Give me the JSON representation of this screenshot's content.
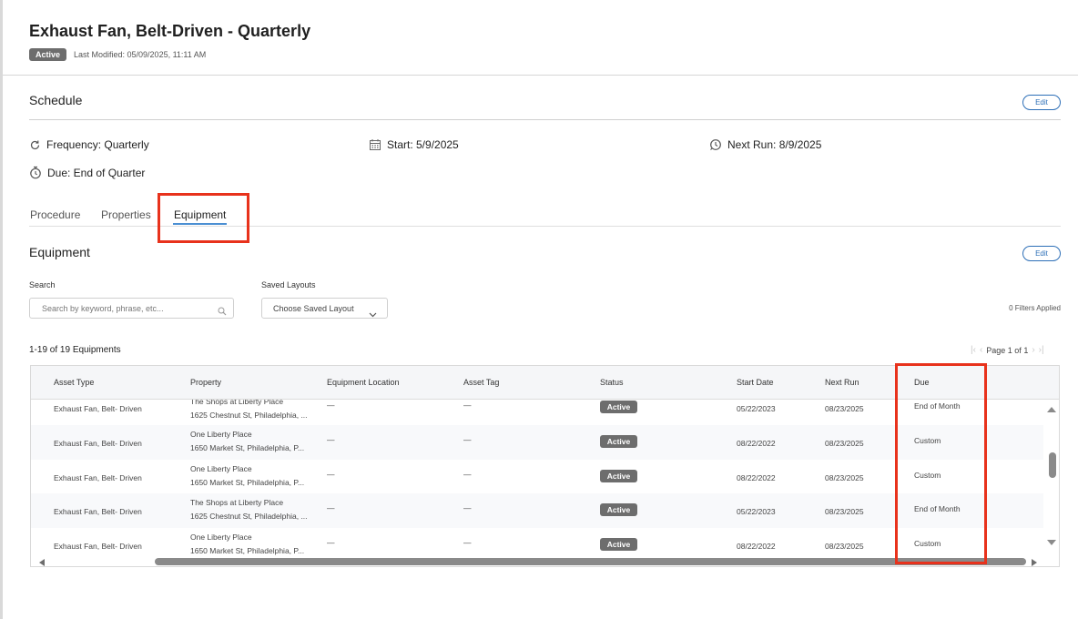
{
  "header": {
    "title": "Exhaust Fan, Belt-Driven - Quarterly",
    "status": "Active",
    "last_modified": "Last Modified: 05/09/2025, 11:11 AM"
  },
  "schedule": {
    "title": "Schedule",
    "edit_label": "Edit",
    "frequency": "Frequency: Quarterly",
    "start": "Start: 5/9/2025",
    "next_run": "Next Run: 8/9/2025",
    "due": "Due: End of Quarter"
  },
  "tabs": [
    {
      "label": "Procedure",
      "active": false
    },
    {
      "label": "Properties",
      "active": false
    },
    {
      "label": "Equipment",
      "active": true
    }
  ],
  "equipment": {
    "title": "Equipment",
    "edit_label": "Edit",
    "search_label": "Search",
    "search_placeholder": "Search by keyword, phrase, etc...",
    "saved_layouts_label": "Saved Layouts",
    "saved_layouts_value": "Choose Saved Layout",
    "filters_applied": "0 Filters Applied",
    "count": "1-19 of 19 Equipments",
    "page_label": "Page 1 of 1"
  },
  "table": {
    "columns": [
      "Asset Type",
      "Property",
      "Equipment Location",
      "Asset Tag",
      "Status",
      "Start Date",
      "Next Run",
      "Due"
    ],
    "rows": [
      {
        "asset_type": "Exhaust Fan, Belt- Driven",
        "property_name": "The Shops at Liberty Place",
        "property_address": "1625 Chestnut St, Philadelphia, ...",
        "location": "—",
        "asset_tag": "—",
        "status": "Active",
        "start_date": "05/22/2023",
        "next_run": "08/23/2025",
        "due": "End of Month"
      },
      {
        "asset_type": "Exhaust Fan, Belt- Driven",
        "property_name": "One Liberty Place",
        "property_address": "1650 Market St, Philadelphia, P...",
        "location": "—",
        "asset_tag": "—",
        "status": "Active",
        "start_date": "08/22/2022",
        "next_run": "08/23/2025",
        "due": "Custom"
      },
      {
        "asset_type": "Exhaust Fan, Belt- Driven",
        "property_name": "One Liberty Place",
        "property_address": "1650 Market St, Philadelphia, P...",
        "location": "—",
        "asset_tag": "—",
        "status": "Active",
        "start_date": "08/22/2022",
        "next_run": "08/23/2025",
        "due": "Custom"
      },
      {
        "asset_type": "Exhaust Fan, Belt- Driven",
        "property_name": "The Shops at Liberty Place",
        "property_address": "1625 Chestnut St, Philadelphia, ...",
        "location": "—",
        "asset_tag": "—",
        "status": "Active",
        "start_date": "05/22/2023",
        "next_run": "08/23/2025",
        "due": "End of Month"
      },
      {
        "asset_type": "Exhaust Fan, Belt- Driven",
        "property_name": "One Liberty Place",
        "property_address": "1650 Market St, Philadelphia, P...",
        "location": "—",
        "asset_tag": "—",
        "status": "Active",
        "start_date": "08/22/2022",
        "next_run": "08/23/2025",
        "due": "Custom"
      }
    ]
  },
  "colors": {
    "highlight": "#e8321c",
    "status_badge": "#6d6d6d",
    "accent": "#2d6fb7",
    "tab_underline": "#4b8fd3"
  },
  "icons": {
    "frequency": "refresh-icon",
    "start": "calendar-icon",
    "next_run": "clock-run-icon",
    "due": "stopwatch-icon",
    "search": "search-icon",
    "select": "chevron-down-icon"
  }
}
